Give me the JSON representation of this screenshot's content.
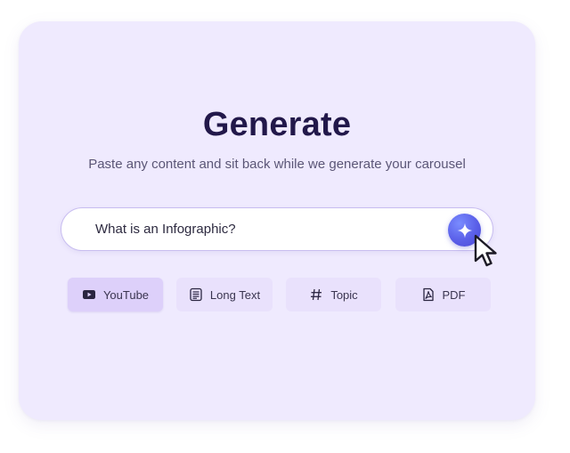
{
  "header": {
    "title": "Generate",
    "subtitle": "Paste any content and sit back while we generate your carousel"
  },
  "search": {
    "value": "What is an Infographic?",
    "button_icon": "sparkle-icon",
    "accent_color": "#5a5fe8"
  },
  "sources": [
    {
      "label": "YouTube",
      "icon": "youtube-icon",
      "active": true
    },
    {
      "label": "Long Text",
      "icon": "document-lines-icon",
      "active": false
    },
    {
      "label": "Topic",
      "icon": "hash-icon",
      "active": false
    },
    {
      "label": "PDF",
      "icon": "pdf-icon",
      "active": false
    }
  ],
  "colors": {
    "card_background": "#efeafe",
    "title": "#22184a",
    "chip_background": "#e9e1fc",
    "chip_active_background": "#ddd0fa"
  }
}
